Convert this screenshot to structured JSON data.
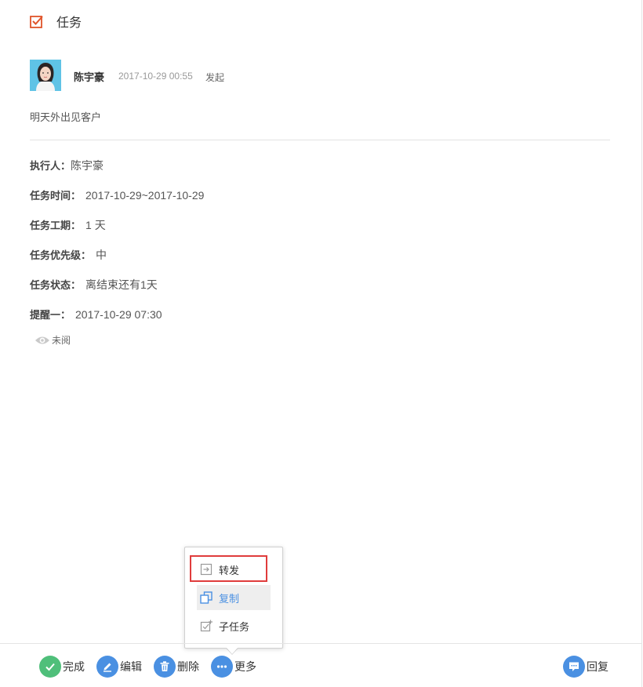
{
  "header": {
    "title": "任务"
  },
  "task": {
    "author": "陈宇豪",
    "created_at": "2017-10-29 00:55",
    "created_action": "发起",
    "content": "明天外出见客户"
  },
  "fields": [
    {
      "label": "执行人：",
      "value": "陈宇豪"
    },
    {
      "label": "任务时间：",
      "value": "2017-10-29~2017-10-29"
    },
    {
      "label": "任务工期：",
      "value": "1 天"
    },
    {
      "label": "任务优先级：",
      "value": "中"
    },
    {
      "label": "任务状态：",
      "value": "离结束还有1天"
    },
    {
      "label": "提醒一：",
      "value": "2017-10-29 07:30"
    }
  ],
  "read_status": "未阅",
  "more_menu": {
    "items": [
      {
        "label": "转发",
        "icon": "forward-icon"
      },
      {
        "label": "复制",
        "icon": "copy-icon"
      },
      {
        "label": "子任务",
        "icon": "subtask-icon"
      }
    ]
  },
  "actions": {
    "complete": "完成",
    "edit": "编辑",
    "delete": "删除",
    "more": "更多",
    "reply": "回复"
  },
  "colors": {
    "accent_orange": "#e0542a",
    "primary_blue": "#4a90e2",
    "complete_green": "#4fbf7a",
    "highlight_red": "#e03c3c"
  }
}
